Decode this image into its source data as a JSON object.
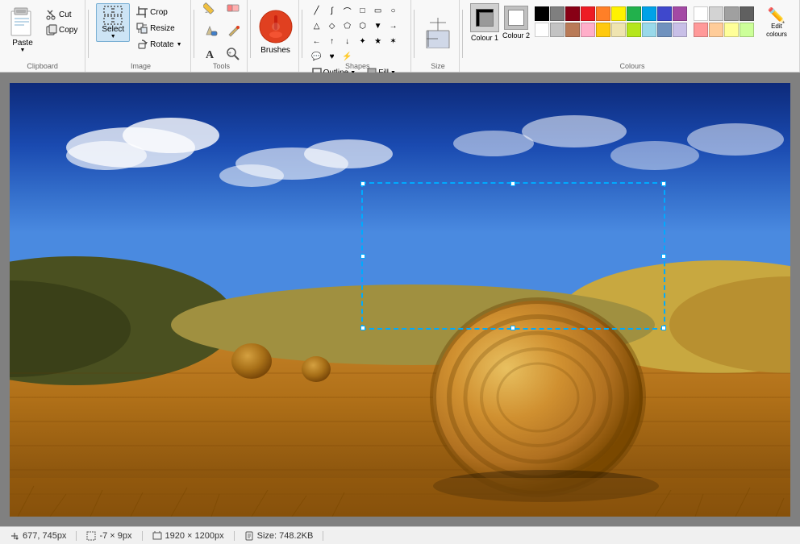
{
  "ribbon": {
    "groups": {
      "clipboard": {
        "label": "Clipboard",
        "paste_label": "Paste",
        "cut_label": "Cut",
        "copy_label": "Copy"
      },
      "image": {
        "label": "Image",
        "crop_label": "Crop",
        "resize_label": "Resize",
        "rotate_label": "Rotate",
        "select_label": "Select"
      },
      "tools": {
        "label": "Tools"
      },
      "brushes": {
        "label": "Brushes"
      },
      "shapes": {
        "label": "Shapes"
      },
      "size": {
        "label": "Size"
      },
      "colours": {
        "label": "Colours",
        "colour1_label": "Colour 1",
        "colour2_label": "Colour 2",
        "edit_colors_label": "Edit colours"
      }
    },
    "outline_label": "Outline",
    "fill_label": "Fill"
  },
  "status_bar": {
    "coordinates": "677, 745px",
    "selection_size": "-7 × 9px",
    "image_size": "1920 × 1200px",
    "file_size": "Size: 748.2KB"
  },
  "colours": {
    "row1": [
      "#000000",
      "#7f7f7f",
      "#880015",
      "#ed1c24",
      "#ff7f27",
      "#fff200",
      "#22b14c",
      "#00a2e8",
      "#3f48cc",
      "#a349a4"
    ],
    "row2": [
      "#ffffff",
      "#c3c3c3",
      "#b97a57",
      "#ffaec9",
      "#ffc90e",
      "#efe4b0",
      "#b5e61d",
      "#99d9ea",
      "#7092be",
      "#c8bfe7"
    ],
    "extra_row1": [
      "#ffffff",
      "#d3d3d3",
      "#a0a0a0",
      "#606060"
    ],
    "extra_row2": [
      "#ff9999",
      "#ffcc99",
      "#ffff99",
      "#ccff99"
    ]
  }
}
